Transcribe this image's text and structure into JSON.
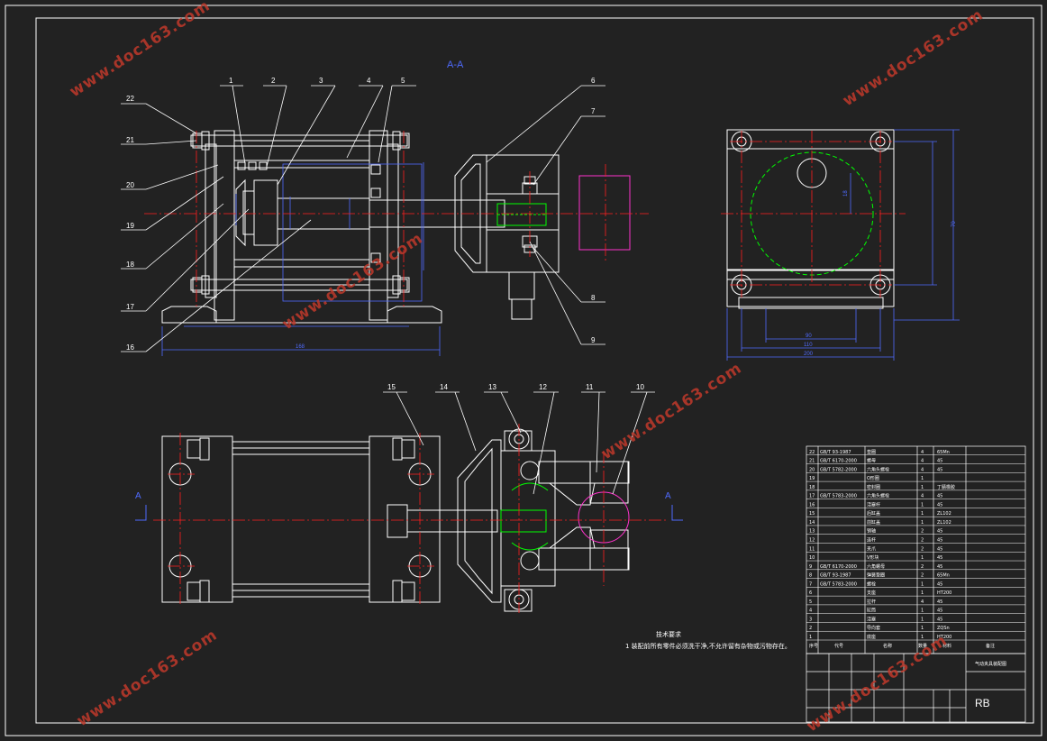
{
  "section_label": "A-A",
  "section_mark": "A",
  "part_numbers": [
    "1",
    "2",
    "3",
    "4",
    "5",
    "6",
    "7",
    "8",
    "9",
    "10",
    "11",
    "12",
    "13",
    "14",
    "15",
    "16",
    "17",
    "18",
    "19",
    "20",
    "21",
    "22"
  ],
  "dimensions": {
    "overall_length": "168",
    "side_height": "70",
    "side_width_inner": "90",
    "side_width_mid": "110",
    "side_width_outer": "200",
    "radius": "18"
  },
  "watermark": "www.doc163.com",
  "notes": {
    "heading": "技术要求",
    "line1": "1 装配前所有零件必须洗干净,不允许留有杂物或污物存在。"
  },
  "title_block": {
    "drawing_name": "气动夹具装配图",
    "code": "RB",
    "rows": [
      {
        "no": "22",
        "code": "GB/T 93-1987",
        "name": "垫圈",
        "qty": "4",
        "mat": "65Mn"
      },
      {
        "no": "21",
        "code": "GB/T 6170-2000",
        "name": "螺母",
        "qty": "4",
        "mat": "45"
      },
      {
        "no": "20",
        "code": "GB/T 5782-2000",
        "name": "六角头螺栓",
        "qty": "4",
        "mat": "45"
      },
      {
        "no": "19",
        "code": "",
        "name": "O形圈",
        "qty": "1",
        "mat": ""
      },
      {
        "no": "18",
        "code": "",
        "name": "密封圈",
        "qty": "1",
        "mat": "丁腈橡胶"
      },
      {
        "no": "17",
        "code": "GB/T 5783-2000",
        "name": "六角头螺栓",
        "qty": "4",
        "mat": "45"
      },
      {
        "no": "16",
        "code": "",
        "name": "活塞杆",
        "qty": "1",
        "mat": "45"
      },
      {
        "no": "15",
        "code": "",
        "name": "后缸盖",
        "qty": "1",
        "mat": "ZL102"
      },
      {
        "no": "14",
        "code": "",
        "name": "前缸盖",
        "qty": "1",
        "mat": "ZL102"
      },
      {
        "no": "13",
        "code": "",
        "name": "销轴",
        "qty": "2",
        "mat": "45"
      },
      {
        "no": "12",
        "code": "",
        "name": "连杆",
        "qty": "2",
        "mat": "45"
      },
      {
        "no": "11",
        "code": "",
        "name": "夹爪",
        "qty": "2",
        "mat": "45"
      },
      {
        "no": "10",
        "code": "",
        "name": "V形块",
        "qty": "1",
        "mat": "45"
      },
      {
        "no": "9",
        "code": "GB/T 6170-2000",
        "name": "六角螺母",
        "qty": "2",
        "mat": "45"
      },
      {
        "no": "8",
        "code": "GB/T 93-1987",
        "name": "弹簧垫圈",
        "qty": "2",
        "mat": "65Mn"
      },
      {
        "no": "7",
        "code": "GB/T 5783-2000",
        "name": "螺栓",
        "qty": "1",
        "mat": "45"
      },
      {
        "no": "6",
        "code": "",
        "name": "支座",
        "qty": "1",
        "mat": "HT200"
      },
      {
        "no": "5",
        "code": "",
        "name": "拉杆",
        "qty": "4",
        "mat": "45"
      },
      {
        "no": "4",
        "code": "",
        "name": "缸筒",
        "qty": "1",
        "mat": "45"
      },
      {
        "no": "3",
        "code": "",
        "name": "活塞",
        "qty": "1",
        "mat": "45"
      },
      {
        "no": "2",
        "code": "",
        "name": "导向套",
        "qty": "1",
        "mat": "ZQSn"
      },
      {
        "no": "1",
        "code": "",
        "name": "底座",
        "qty": "1",
        "mat": "HT200"
      }
    ],
    "header": {
      "no": "序号",
      "code": "代号",
      "name": "名称",
      "qty": "数量",
      "mat": "材料",
      "note": "备注"
    }
  },
  "colors": {
    "background": "#222222",
    "outline": "#ffffff",
    "centerline": "#ff2020",
    "dimension": "#4f6bff",
    "hidden": "#00ff00",
    "phantom": "#ff33cc",
    "watermark": "#c0392b"
  }
}
